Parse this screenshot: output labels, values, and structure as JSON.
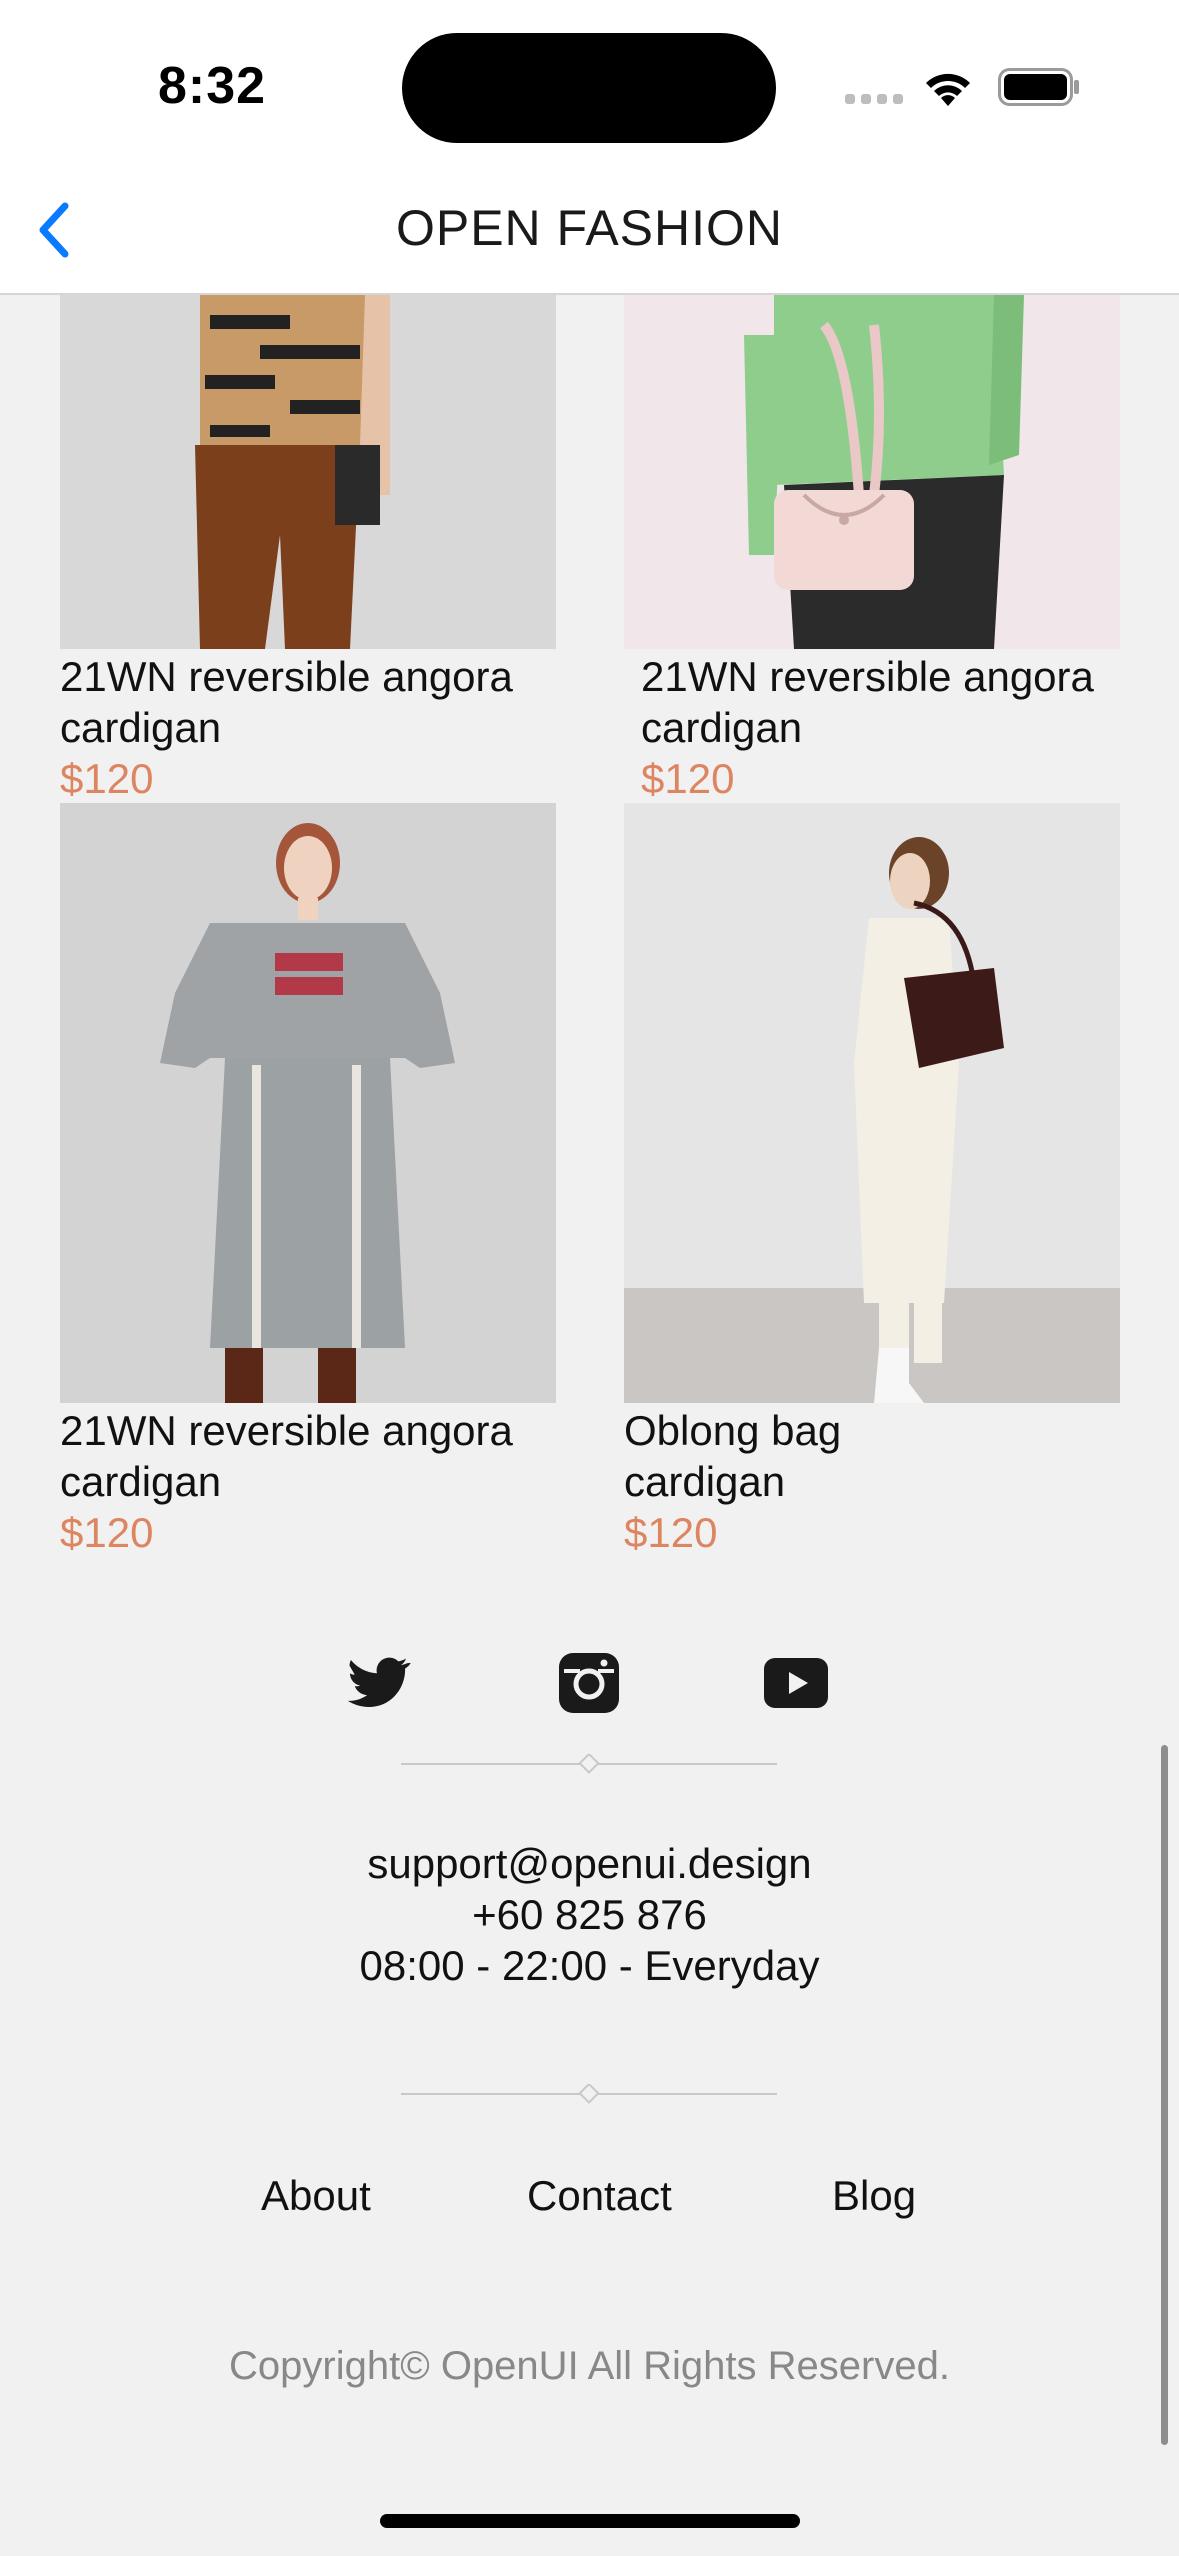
{
  "status_bar": {
    "time": "8:32"
  },
  "nav": {
    "title": "OPEN FASHION",
    "back_icon": "chevron-left-icon",
    "accent_color": "#0a7aff"
  },
  "products": [
    {
      "name_line1": "21WN reversible angora",
      "name_line2": "cardigan",
      "price": "$120"
    },
    {
      "name_line1": "21WN reversible angora",
      "name_line2": "cardigan",
      "price": "$120"
    },
    {
      "name_line1": "21WN reversible angora",
      "name_line2": "cardigan",
      "price": "$120"
    },
    {
      "name_line1": "Oblong bag",
      "name_line2": "cardigan",
      "price": "$120"
    }
  ],
  "price_color": "#dd8560",
  "social": {
    "icons": [
      "twitter-icon",
      "instagram-icon",
      "youtube-icon"
    ]
  },
  "contact": {
    "email": "support@openui.design",
    "phone": "+60 825 876",
    "hours": "08:00 - 22:00 - Everyday"
  },
  "footer_links": {
    "about": "About",
    "contact": "Contact",
    "blog": "Blog"
  },
  "copyright": "Copyright© OpenUI All Rights Reserved."
}
